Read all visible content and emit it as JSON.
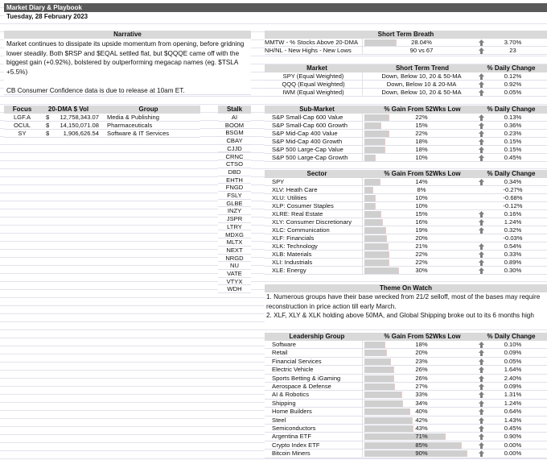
{
  "header": {
    "title": "Market Diary & Playbook",
    "date": "Tuesday, 28 February 2023"
  },
  "narrative": {
    "title": "Narrative",
    "paragraph1": "Market continues to dissipate its upside momentum from opening, before gridning lower steadily. Both $RSP and $EQAL settled flat, but $QQQE came off with the biggest gain (+0.92%), bolstered by outperforming megacap names (eg. $TSLA +5.5%)",
    "paragraph2": "CB Consumer Confidence data is due to release at 10am ET."
  },
  "focus": {
    "headers": [
      "Focus",
      "20-DMA $ Vol",
      "Group"
    ],
    "rows": [
      {
        "ticker": "LGF.A",
        "cur": "$",
        "vol": "12,758,343.07",
        "group": "Media & Publishing"
      },
      {
        "ticker": "OCUL",
        "cur": "$",
        "vol": "14,150,071.08",
        "group": "Pharmaceuticals"
      },
      {
        "ticker": "SY",
        "cur": "$",
        "vol": "1,906,626.54",
        "group": "Software & IT Services"
      }
    ]
  },
  "stalk": {
    "header": "Stalk",
    "items": [
      "AI",
      "BOOM",
      "BSGM",
      "CBAY",
      "CJJD",
      "CRNC",
      "CTSO",
      "DBD",
      "EHTH",
      "FNGD",
      "FSLY",
      "GLBE",
      "INZY",
      "JSPR",
      "LTRY",
      "MDXG",
      "MLTX",
      "NEXT",
      "NRGD",
      "NU",
      "VATE",
      "VTYX",
      "WDH"
    ]
  },
  "breath": {
    "title": "Short Term Breath",
    "rows": [
      {
        "label": "MMTW - % Stocks Above 20-DMA",
        "value": "28.04%",
        "bar": 28.04,
        "up": true,
        "change": "3.70%"
      },
      {
        "label": "NH/NL - New Highs - New Lows",
        "value": "90 vs 67",
        "up": true,
        "change": "23"
      }
    ]
  },
  "market": {
    "headers": [
      "Market",
      "Short Term Trend",
      "% Daily Change"
    ],
    "rows": [
      {
        "label": "SPY (Equal Weighted)",
        "value": "Down, Below 10, 20 & 50-MA",
        "up": true,
        "change": "0.12%"
      },
      {
        "label": "QQQ (Equal Weighted)",
        "value": "Down, Below 10 & 20-MA",
        "up": true,
        "change": "0.92%"
      },
      {
        "label": "IWM (Equal Weighted)",
        "value": "Down, Below 10, 20 & 50-MA",
        "up": true,
        "change": "0.05%"
      }
    ]
  },
  "submarket": {
    "headers": [
      "Sub-Market",
      "% Gain From 52Wks Low",
      "% Daily Change"
    ],
    "rows": [
      {
        "label": "S&P Small-Cap 600 Value",
        "value": "22%",
        "bar": 22,
        "up": true,
        "change": "0.13%"
      },
      {
        "label": "S&P Small-Cap 600 Growth",
        "value": "15%",
        "bar": 15,
        "up": true,
        "change": "0.36%"
      },
      {
        "label": "S&P Mid-Cap 400 Value",
        "value": "22%",
        "bar": 22,
        "up": true,
        "change": "0.23%"
      },
      {
        "label": "S&P Mid-Cap 400 Growth",
        "value": "18%",
        "bar": 18,
        "up": true,
        "change": "0.15%"
      },
      {
        "label": "S&P 500 Large-Cap Value",
        "value": "18%",
        "bar": 18,
        "up": true,
        "change": "0.15%"
      },
      {
        "label": "S&P 500 Large-Cap Growth",
        "value": "10%",
        "bar": 10,
        "up": true,
        "change": "0.45%"
      }
    ]
  },
  "sector": {
    "headers": [
      "Sector",
      "% Gain From 52Wks Low",
      "% Daily Change"
    ],
    "rows": [
      {
        "label": "SPY",
        "value": "14%",
        "bar": 14,
        "up": true,
        "change": "0.34%"
      },
      {
        "label": "XLV:  Heath Care",
        "value": "8%",
        "bar": 8,
        "up": false,
        "change": "-0.27%"
      },
      {
        "label": "XLU:  Utilities",
        "value": "10%",
        "bar": 10,
        "up": false,
        "change": "-0.68%"
      },
      {
        "label": "XLP:  Cosumer Staples",
        "value": "10%",
        "bar": 10,
        "up": false,
        "change": "-0.12%"
      },
      {
        "label": "XLRE: Real Estate",
        "value": "15%",
        "bar": 15,
        "up": true,
        "change": "0.16%"
      },
      {
        "label": "XLY:  Consumer Discretionary",
        "value": "16%",
        "bar": 16,
        "up": true,
        "change": "1.24%"
      },
      {
        "label": "XLC:  Communication",
        "value": "19%",
        "bar": 19,
        "up": true,
        "change": "0.32%"
      },
      {
        "label": "XLF:   Financials",
        "value": "20%",
        "bar": 20,
        "up": false,
        "change": "-0.03%"
      },
      {
        "label": "XLK:  Technology",
        "value": "21%",
        "bar": 21,
        "up": true,
        "change": "0.54%"
      },
      {
        "label": "XLB:   Materials",
        "value": "22%",
        "bar": 22,
        "up": true,
        "change": "0.33%"
      },
      {
        "label": "XLI:    Industrials",
        "value": "22%",
        "bar": 22,
        "up": true,
        "change": "0.89%"
      },
      {
        "label": "XLE:  Energy",
        "value": "30%",
        "bar": 30,
        "up": true,
        "change": "0.30%"
      }
    ]
  },
  "theme": {
    "title": "Theme On Watch",
    "line1": "1. Numerous groups have their base wrecked from 21/2 selloff, most of the bases may require reconstruction in price action till early March.",
    "line2": "2. XLF, XLY & XLK holding above 50MA, and Global Shipping broke out to its 6 months high"
  },
  "leadership": {
    "headers": [
      "Leadership Group",
      "% Gain From 52Wks Low",
      "% Daily Change"
    ],
    "rows": [
      {
        "label": "Software",
        "value": "18%",
        "bar": 18,
        "up": true,
        "change": "0.10%"
      },
      {
        "label": "Retail",
        "value": "20%",
        "bar": 20,
        "up": true,
        "change": "0.09%"
      },
      {
        "label": "Financial Services",
        "value": "23%",
        "bar": 23,
        "up": true,
        "change": "0.05%"
      },
      {
        "label": "Electric Vehicle",
        "value": "26%",
        "bar": 26,
        "up": true,
        "change": "1.64%"
      },
      {
        "label": "Sports Betting & iGaming",
        "value": "26%",
        "bar": 26,
        "up": true,
        "change": "2.40%"
      },
      {
        "label": "Aerospace & Defense",
        "value": "27%",
        "bar": 27,
        "up": true,
        "change": "0.09%"
      },
      {
        "label": "AI & Robotics",
        "value": "33%",
        "bar": 33,
        "up": true,
        "change": "1.31%"
      },
      {
        "label": "Shipping",
        "value": "34%",
        "bar": 34,
        "up": true,
        "change": "1.24%"
      },
      {
        "label": "Home Builders",
        "value": "40%",
        "bar": 40,
        "up": true,
        "change": "0.64%"
      },
      {
        "label": "Steel",
        "value": "42%",
        "bar": 42,
        "up": true,
        "change": "1.43%"
      },
      {
        "label": "Semiconductors",
        "value": "43%",
        "bar": 43,
        "up": true,
        "change": "0.45%"
      },
      {
        "label": "Argentina ETF",
        "value": "71%",
        "bar": 71,
        "up": true,
        "change": "0.90%"
      },
      {
        "label": "Crypto Index ETF",
        "value": "85%",
        "bar": 85,
        "up": true,
        "change": "0.00%"
      },
      {
        "label": "Bitcoin Miners",
        "value": "90%",
        "bar": 90,
        "up": true,
        "change": "0.00%"
      }
    ]
  },
  "colors": {
    "title_bar": "#595959",
    "header_fill": "#d9d9d9",
    "data_bar": "#cfcfcf",
    "arrow": "#7f7f7f"
  }
}
